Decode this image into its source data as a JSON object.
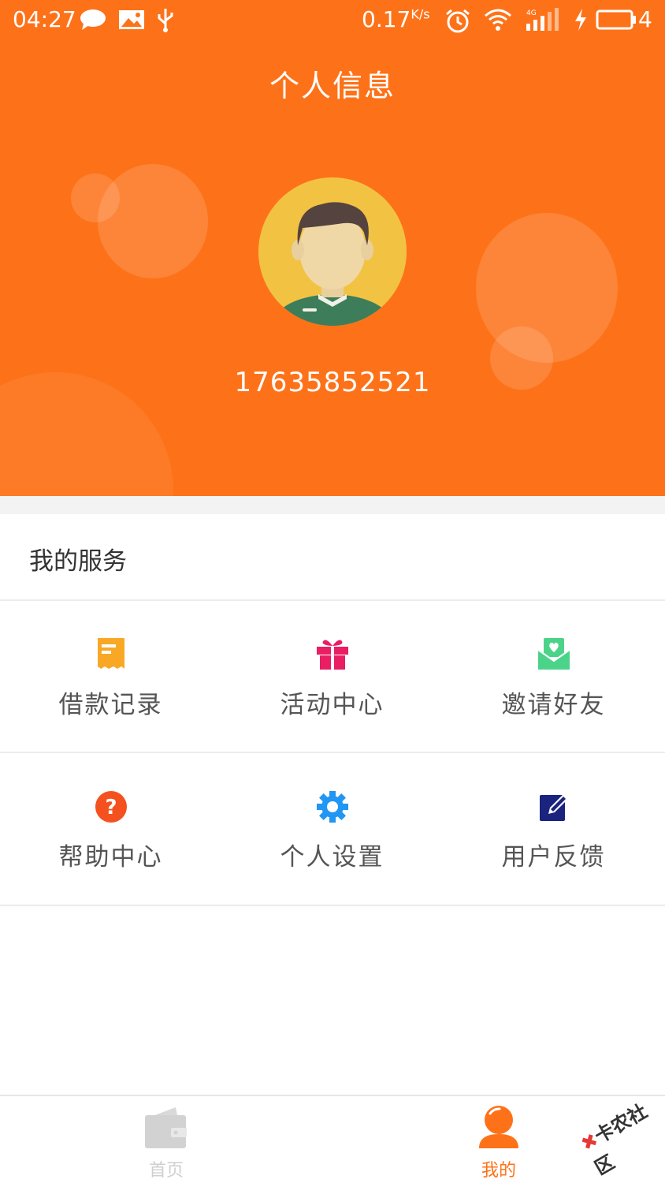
{
  "status_bar": {
    "time": "04:27",
    "speed": "0.17",
    "speed_unit": "K/s",
    "battery": "4"
  },
  "header": {
    "title": "个人信息",
    "phone": "17635852521",
    "bg_color": "#fd7219"
  },
  "services": {
    "title": "我的服务",
    "items": [
      {
        "label": "借款记录",
        "icon": "receipt-icon",
        "color": "#f9a825"
      },
      {
        "label": "活动中心",
        "icon": "gift-icon",
        "color": "#e91e63"
      },
      {
        "label": "邀请好友",
        "icon": "invite-envelope-icon",
        "color": "#4cd38a"
      },
      {
        "label": "帮助中心",
        "icon": "help-icon",
        "color": "#f4511e"
      },
      {
        "label": "个人设置",
        "icon": "gear-icon",
        "color": "#2196f3"
      },
      {
        "label": "用户反馈",
        "icon": "edit-icon",
        "color": "#1a237e"
      }
    ]
  },
  "tabbar": {
    "home": {
      "label": "首页",
      "icon": "wallet-icon",
      "color": "#cfcfcf"
    },
    "mine": {
      "label": "我的",
      "icon": "user-icon",
      "color": "#fd7219"
    }
  },
  "watermark": "卡农社区"
}
